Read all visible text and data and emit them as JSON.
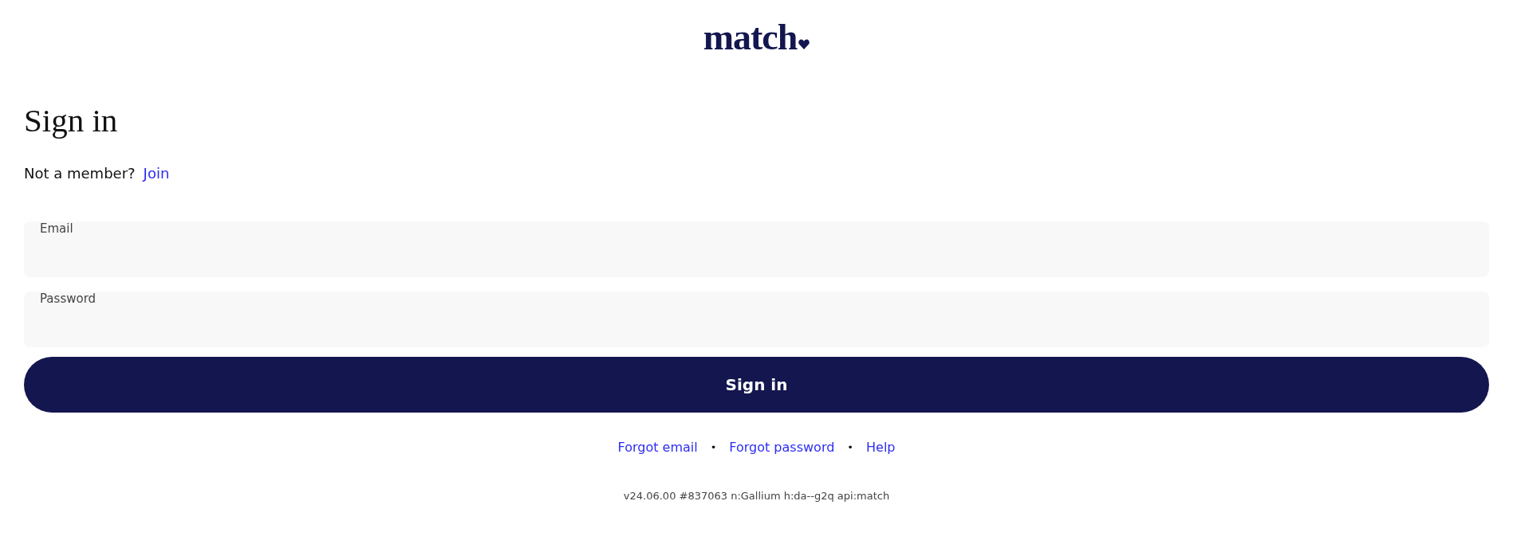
{
  "logo": {
    "text": "match"
  },
  "heading": "Sign in",
  "join_prompt": {
    "text": "Not a member?",
    "link": "Join"
  },
  "fields": [
    {
      "label": "Email"
    },
    {
      "label": "Password"
    }
  ],
  "submit_button": "Sign in",
  "footer_links": [
    {
      "kind": "link",
      "text": "Forgot email"
    },
    {
      "kind": "separator",
      "text": "•"
    },
    {
      "kind": "link",
      "text": "Forgot password"
    },
    {
      "kind": "separator",
      "text": "•"
    },
    {
      "kind": "link",
      "text": "Help"
    }
  ],
  "version": "v24.06.00 #837063 n:Gallium h:da--g2q api:match"
}
